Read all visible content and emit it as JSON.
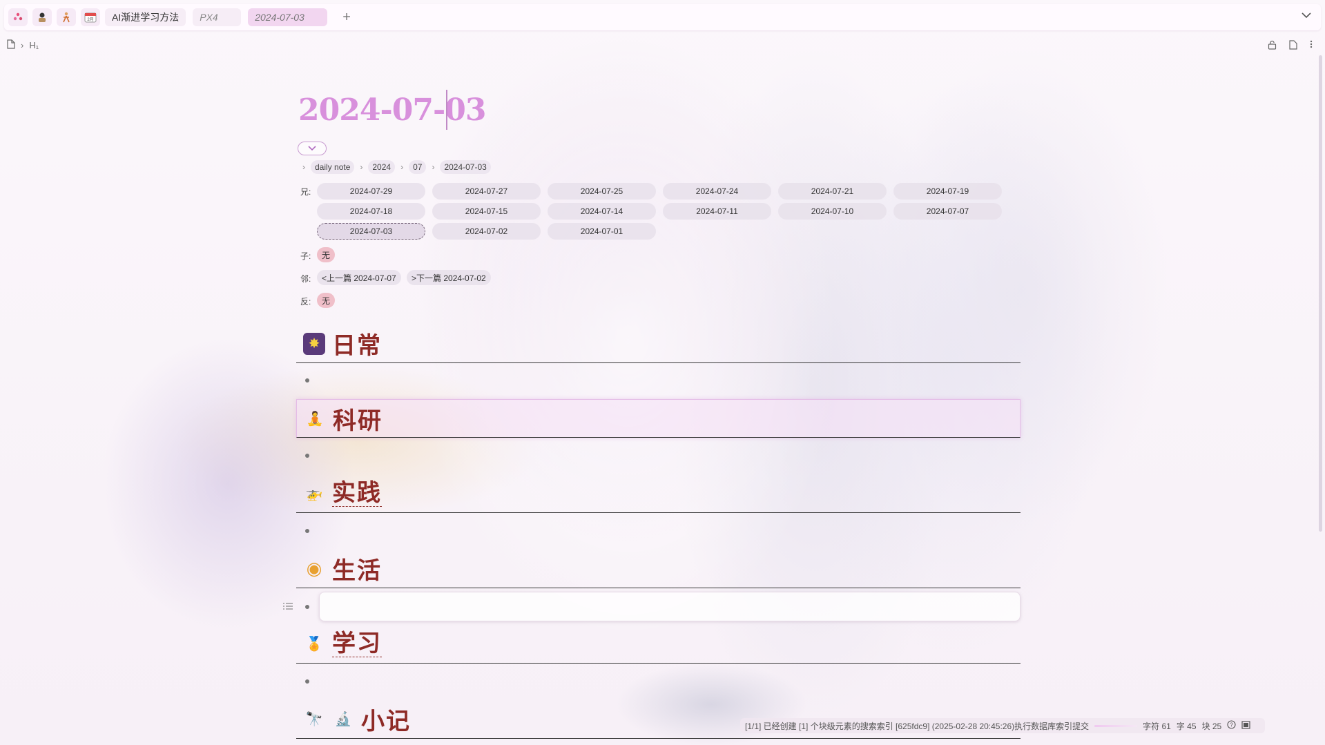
{
  "tabs": {
    "icons": [
      "app-icon",
      "avatar-icon",
      "figure-icon",
      "calendar-icon"
    ],
    "items": [
      {
        "label": "AI渐进学习方法",
        "style": "normal"
      },
      {
        "label": "PX4",
        "style": "italic"
      },
      {
        "label": "2024-07-03",
        "style": "active"
      }
    ],
    "plus": "+",
    "dropdown": "⌄"
  },
  "topcrumb": {
    "heading_marker": "H₁"
  },
  "doc": {
    "title": "2024-07-03"
  },
  "crumbs": [
    "daily note",
    "2024",
    "07",
    "2024-07-03"
  ],
  "relations": {
    "parent_label": "兄:",
    "siblings": [
      "2024-07-29",
      "2024-07-27",
      "2024-07-25",
      "2024-07-24",
      "2024-07-21",
      "2024-07-19",
      "2024-07-18",
      "2024-07-15",
      "2024-07-14",
      "2024-07-11",
      "2024-07-10",
      "2024-07-07",
      "2024-07-03",
      "2024-07-02",
      "2024-07-01"
    ],
    "current_index": 12,
    "child_label": "子:",
    "child_value": "无",
    "neighbor_label": "邻:",
    "prev": "<上一篇 2024-07-07",
    "next": ">下一篇 2024-07-02",
    "back_label": "反:",
    "back_value": "无"
  },
  "sections": [
    {
      "title": "日常",
      "icon": "sparkle-icon",
      "glyph": "✸"
    },
    {
      "title": "科研",
      "icon": "meditation-icon",
      "glyph": "🧘"
    },
    {
      "title": "实践",
      "icon": "helicopter-icon",
      "glyph": "🚁"
    },
    {
      "title": "生活",
      "icon": "disc-icon",
      "glyph": "◉"
    },
    {
      "title": "学习",
      "icon": "medal-icon",
      "glyph": "🏅"
    },
    {
      "title": "小记",
      "icon": "telescope-icon",
      "glyph": "🔭"
    }
  ],
  "status": {
    "message": "[1/1] 已经创建 [1] 个块级元素的搜索索引 [625fdc9] (2025-02-28 20:45:26)执行数据库索引提交",
    "chars": "字符 61",
    "words": "字 45",
    "blocks": "块 25"
  }
}
